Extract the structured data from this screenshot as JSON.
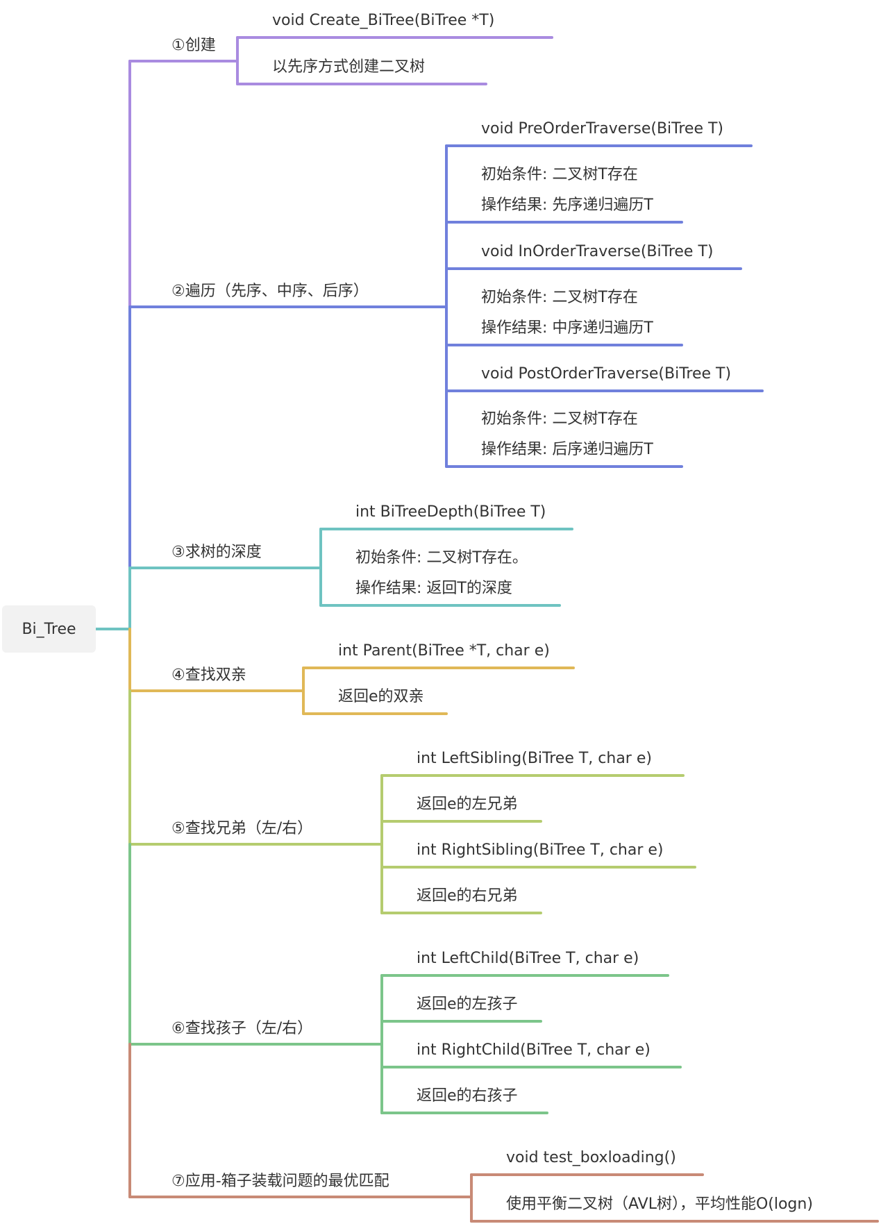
{
  "root": {
    "label": "Bi_Tree",
    "color": "#6ec3c1"
  },
  "branches": [
    {
      "label": "①创建",
      "color": "#a98be0",
      "leaves": [
        {
          "lines": [
            "void Create_BiTree(BiTree *T)"
          ]
        },
        {
          "lines": [
            "以先序方式创建二叉树"
          ]
        }
      ]
    },
    {
      "label": "②遍历（先序、中序、后序）",
      "color": "#7080dc",
      "leaves": [
        {
          "lines": [
            "void PreOrderTraverse(BiTree T)"
          ]
        },
        {
          "lines": [
            "初始条件: 二叉树T存在",
            "操作结果: 先序递归遍历T"
          ]
        },
        {
          "lines": [
            "void InOrderTraverse(BiTree T)"
          ]
        },
        {
          "lines": [
            "初始条件: 二叉树T存在",
            "操作结果: 中序递归遍历T"
          ]
        },
        {
          "lines": [
            "void PostOrderTraverse(BiTree T)"
          ]
        },
        {
          "lines": [
            "初始条件: 二叉树T存在",
            "操作结果: 后序递归遍历T"
          ]
        }
      ]
    },
    {
      "label": "③求树的深度",
      "color": "#6ec3c1",
      "leaves": [
        {
          "lines": [
            "int BiTreeDepth(BiTree T)"
          ]
        },
        {
          "lines": [
            "初始条件: 二叉树T存在。",
            "操作结果: 返回T的深度"
          ]
        }
      ]
    },
    {
      "label": "④查找双亲",
      "color": "#e0b857",
      "leaves": [
        {
          "lines": [
            "int Parent(BiTree *T, char e)"
          ]
        },
        {
          "lines": [
            "返回e的双亲"
          ]
        }
      ]
    },
    {
      "label": "⑤查找兄弟（左/右）",
      "color": "#b5cc6f",
      "leaves": [
        {
          "lines": [
            "int LeftSibling(BiTree T, char e)"
          ]
        },
        {
          "lines": [
            "返回e的左兄弟"
          ]
        },
        {
          "lines": [
            "int RightSibling(BiTree T, char e)"
          ]
        },
        {
          "lines": [
            "返回e的右兄弟"
          ]
        }
      ]
    },
    {
      "label": "⑥查找孩子（左/右）",
      "color": "#7cc58a",
      "leaves": [
        {
          "lines": [
            "int LeftChild(BiTree T, char e)"
          ]
        },
        {
          "lines": [
            "返回e的左孩子"
          ]
        },
        {
          "lines": [
            "int RightChild(BiTree T, char e)"
          ]
        },
        {
          "lines": [
            "返回e的右孩子"
          ]
        }
      ]
    },
    {
      "label": "⑦应用-箱子装载问题的最优匹配",
      "color": "#c88a76",
      "leaves": [
        {
          "lines": [
            "void test_boxloading()"
          ]
        },
        {
          "lines": [
            "使用平衡二叉树（AVL树），平均性能O(logn)"
          ]
        }
      ]
    }
  ]
}
